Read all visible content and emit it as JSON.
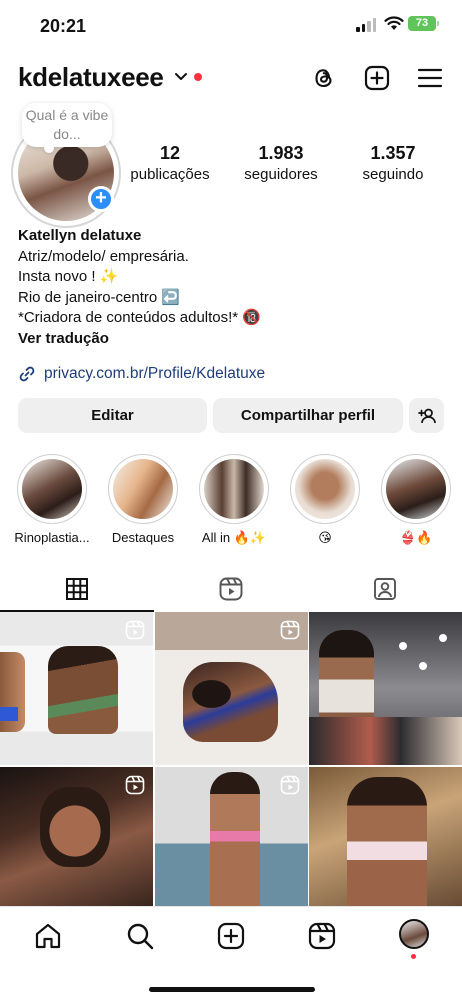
{
  "status_bar": {
    "time": "20:21",
    "battery": "73"
  },
  "header": {
    "username": "kdelatuxeee",
    "icons": [
      "threads-icon",
      "create-post-icon",
      "menu-icon"
    ]
  },
  "profile": {
    "note": "Qual é a vibe do...",
    "stats": [
      {
        "value": "12",
        "label": "publicações"
      },
      {
        "value": "1.983",
        "label": "seguidores"
      },
      {
        "value": "1.357",
        "label": "seguindo"
      }
    ],
    "name": "Katellyn delatuxe",
    "bio_lines": [
      "Atriz/modelo/ empresária.",
      "Insta novo ! ✨",
      "Rio de janeiro-centro ↩️",
      "*Criadora de conteúdos adultos!* 🔞"
    ],
    "translate": "Ver tradução",
    "link": "privacy.com.br/Profile/Kdelatuxe"
  },
  "buttons": {
    "edit": "Editar",
    "share": "Compartilhar perfil"
  },
  "highlights": [
    {
      "label": "Rinoplastia..."
    },
    {
      "label": "Destaques"
    },
    {
      "label": "All in 🔥✨"
    },
    {
      "label": "😘"
    },
    {
      "label": "👙🔥"
    }
  ],
  "tabs": [
    "grid-icon",
    "reels-icon",
    "tagged-icon"
  ],
  "bottom_nav": [
    "home-icon",
    "search-icon",
    "create-icon",
    "reels-icon",
    "profile-avatar"
  ]
}
